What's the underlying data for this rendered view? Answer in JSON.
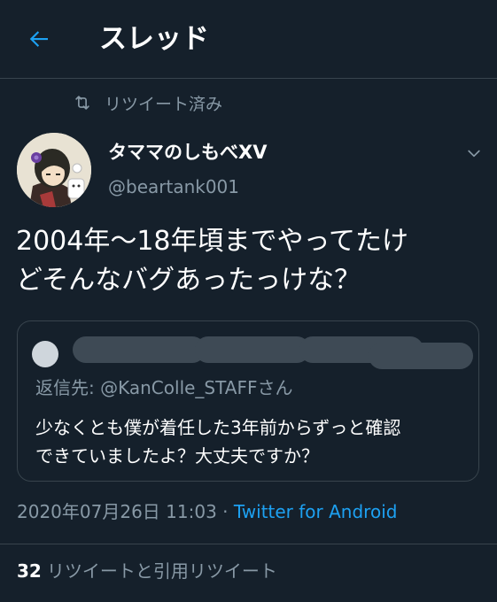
{
  "header": {
    "title": "スレッド",
    "back_icon": "arrow-left-icon"
  },
  "retweet_banner": {
    "icon": "retweet-icon",
    "text": "リツイート済み"
  },
  "tweet": {
    "display_name": "タママのしもべXV",
    "handle": "@beartank001",
    "text_line1": "2004年〜18年頃までやってたけ",
    "text_line2": "どそんなバグあったっけな？",
    "timestamp": "2020年07月26日 11:03",
    "separator": " · ",
    "source": "Twitter for Android"
  },
  "quote": {
    "reply_to_prefix": "返信先: ",
    "reply_to_mention": "@KanColle_STAFF",
    "reply_to_suffix": "さん",
    "text_line1": "少なくとも僕が着任した3年前からずっと確認",
    "text_line2": "できていましたよ？大丈夫ですか？"
  },
  "stats": {
    "retweet_count": "32",
    "retweet_label": "リツイートと引用リツイート"
  },
  "colors": {
    "background": "#15202b",
    "accent": "#1da1f2",
    "secondary_text": "#8899a6",
    "border": "#38444d"
  }
}
